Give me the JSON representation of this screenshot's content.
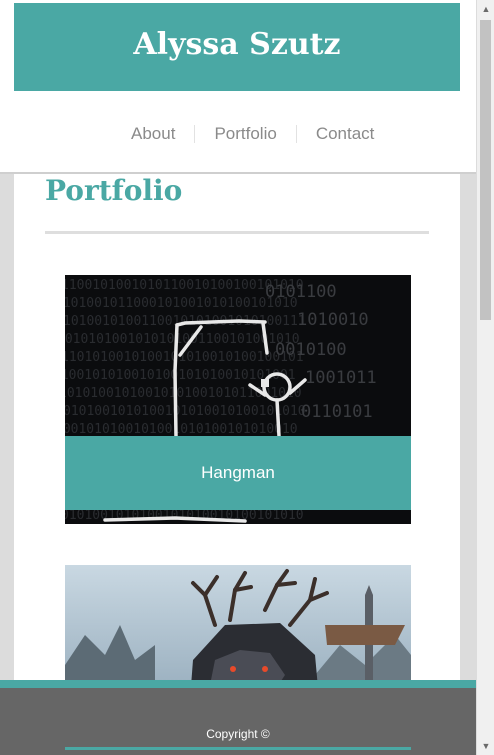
{
  "site": {
    "title": "Alyssa Szutz"
  },
  "nav": {
    "items": [
      "About",
      "Portfolio",
      "Contact"
    ]
  },
  "main": {
    "heading": "Portfolio",
    "projects": [
      {
        "caption": "Hangman",
        "image_icon": "hangman-image"
      },
      {
        "caption": "",
        "image_icon": "fantasy-warrior-image"
      }
    ]
  },
  "footer": {
    "copyright": "Copyright ©"
  },
  "colors": {
    "accent": "#4aa8a4",
    "footer_bg": "#666666",
    "nav_text": "#8a8a8a"
  }
}
